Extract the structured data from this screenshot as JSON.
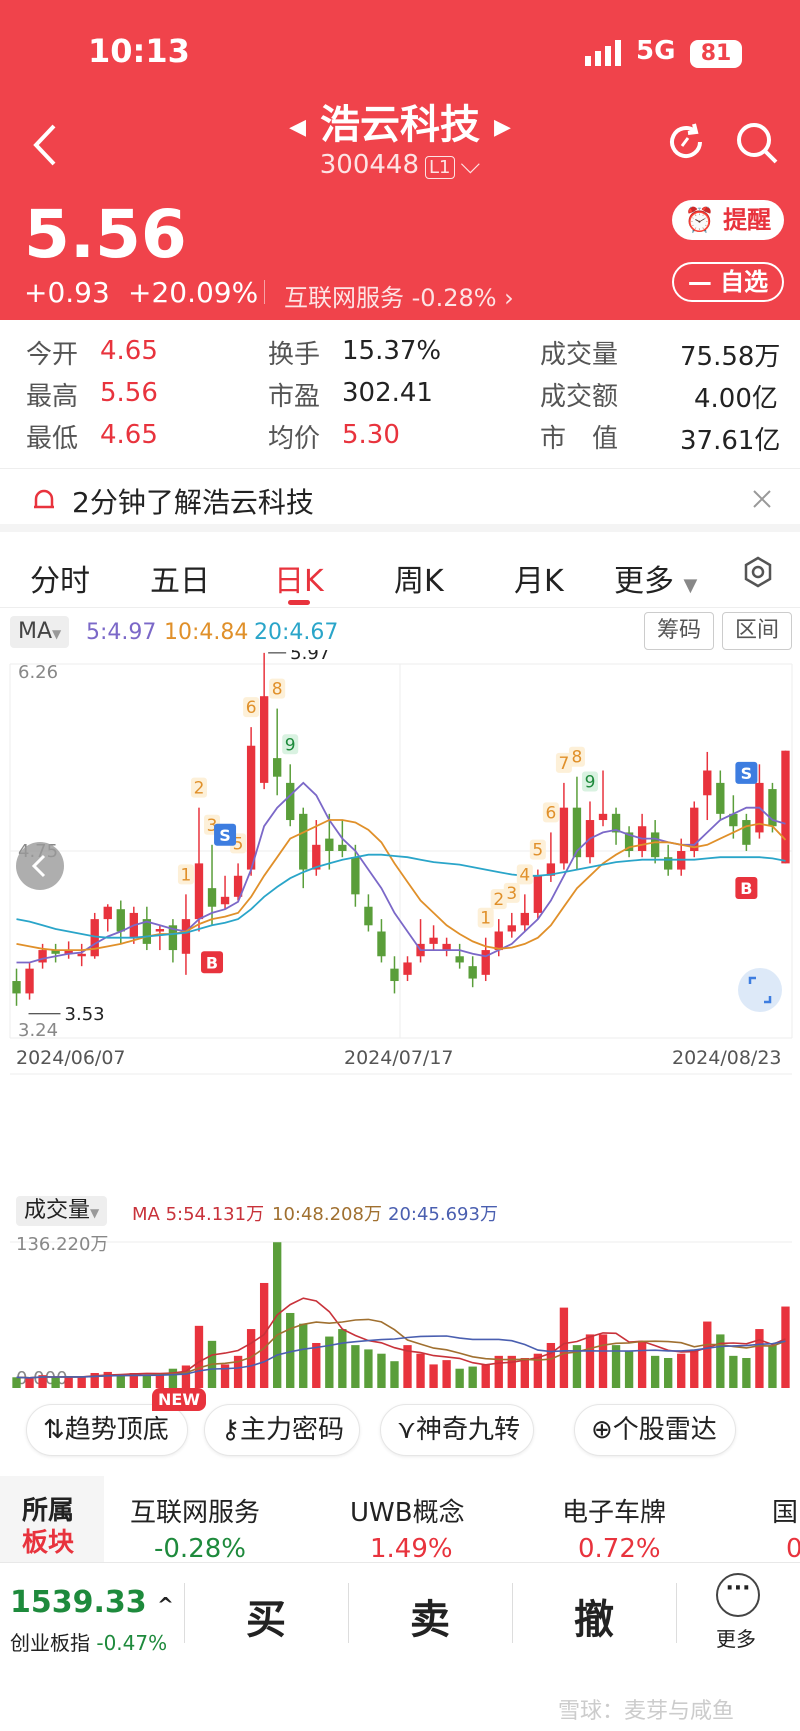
{
  "status": {
    "time": "10:13",
    "network": "5G",
    "battery": "81"
  },
  "header": {
    "name": "浩云科技",
    "code": "300448",
    "level": "L1",
    "remind": "提醒",
    "watch": "自选"
  },
  "quote": {
    "price": "5.56",
    "change": "+0.93",
    "change_pct": "+20.09%",
    "sector": "互联网服务",
    "sector_pct": "-0.28%"
  },
  "stats": [
    {
      "label": "今开",
      "value": "4.65"
    },
    {
      "label": "换手",
      "value": "15.37%"
    },
    {
      "label": "成交量",
      "value": "75.58万"
    },
    {
      "label": "最高",
      "value": "5.56"
    },
    {
      "label": "市盈",
      "value": "302.41"
    },
    {
      "label": "成交额",
      "value": "4.00亿"
    },
    {
      "label": "最低",
      "value": "4.65"
    },
    {
      "label": "均价",
      "value": "5.30"
    },
    {
      "label": "市　值",
      "value": "37.61亿"
    }
  ],
  "learn": "2分钟了解浩云科技",
  "tabs": [
    "分时",
    "五日",
    "日K",
    "周K",
    "月K",
    "更多"
  ],
  "active_tab": "日K",
  "ma": {
    "btn": "MA",
    "ma5": "5:4.97",
    "ma10": "10:4.84",
    "ma20": "20:4.67",
    "chips": "筹码",
    "range": "区间"
  },
  "colors": {
    "up": "#e8333d",
    "down": "#5a9e3a",
    "ma5": "#7b68c8",
    "ma10": "#e0902a",
    "ma20": "#2aa5c9"
  },
  "chart_data": {
    "type": "candlestick",
    "price_range": [
      3.24,
      6.26
    ],
    "y_ticks": [
      "6.26",
      "4.75",
      "3.24"
    ],
    "dates": [
      "2024/06/07",
      "2024/07/17",
      "2024/08/23"
    ],
    "high_label": "5.97",
    "low_label": "3.53",
    "candles": [
      [
        3.7,
        3.6,
        3.8,
        3.5
      ],
      [
        3.6,
        3.8,
        3.85,
        3.55
      ],
      [
        3.85,
        3.95,
        4.0,
        3.8
      ],
      [
        3.95,
        3.92,
        4.0,
        3.85
      ],
      [
        3.92,
        3.95,
        4.02,
        3.88
      ],
      [
        3.9,
        3.92,
        4.0,
        3.82
      ],
      [
        3.9,
        4.2,
        4.25,
        3.88
      ],
      [
        4.2,
        4.3,
        4.32,
        4.1
      ],
      [
        4.28,
        4.1,
        4.35,
        4.0
      ],
      [
        4.05,
        4.25,
        4.3,
        4.0
      ],
      [
        4.2,
        4.0,
        4.3,
        3.95
      ],
      [
        4.1,
        4.12,
        4.15,
        3.95
      ],
      [
        4.15,
        3.95,
        4.2,
        3.85
      ],
      [
        3.92,
        4.2,
        4.4,
        3.75
      ],
      [
        4.2,
        4.65,
        5.1,
        4.1
      ],
      [
        4.45,
        4.3,
        4.8,
        4.15
      ],
      [
        4.32,
        4.38,
        4.55,
        4.28
      ],
      [
        4.38,
        4.55,
        4.65,
        4.35
      ],
      [
        4.6,
        5.6,
        5.75,
        4.55
      ],
      [
        5.3,
        6.0,
        6.35,
        5.25
      ],
      [
        5.5,
        5.35,
        5.9,
        5.2
      ],
      [
        5.3,
        5.0,
        5.45,
        4.95
      ],
      [
        5.05,
        4.6,
        5.1,
        4.45
      ],
      [
        4.6,
        4.8,
        5.0,
        4.55
      ],
      [
        4.85,
        4.75,
        5.05,
        4.6
      ],
      [
        4.8,
        4.75,
        5.0,
        4.7
      ],
      [
        4.7,
        4.4,
        4.8,
        4.3
      ],
      [
        4.3,
        4.15,
        4.4,
        4.1
      ],
      [
        4.1,
        3.9,
        4.2,
        3.85
      ],
      [
        3.8,
        3.7,
        3.9,
        3.6
      ],
      [
        3.75,
        3.85,
        3.9,
        3.7
      ],
      [
        3.9,
        4.0,
        4.2,
        3.85
      ],
      [
        4.0,
        4.05,
        4.15,
        3.95
      ],
      [
        3.95,
        4.0,
        4.05,
        3.9
      ],
      [
        3.9,
        3.85,
        4.0,
        3.8
      ],
      [
        3.82,
        3.72,
        3.9,
        3.65
      ],
      [
        3.75,
        3.95,
        4.05,
        3.7
      ],
      [
        3.95,
        4.1,
        4.2,
        3.9
      ],
      [
        4.1,
        4.15,
        4.25,
        4.05
      ],
      [
        4.15,
        4.25,
        4.4,
        4.1
      ],
      [
        4.25,
        4.55,
        4.6,
        4.2
      ],
      [
        4.55,
        4.65,
        4.9,
        4.5
      ],
      [
        4.65,
        5.1,
        5.3,
        4.6
      ],
      [
        5.1,
        4.7,
        5.35,
        4.6
      ],
      [
        4.7,
        5.0,
        5.15,
        4.65
      ],
      [
        5.0,
        5.05,
        5.4,
        4.95
      ],
      [
        5.05,
        4.9,
        5.1,
        4.8
      ],
      [
        4.9,
        4.75,
        4.95,
        4.7
      ],
      [
        4.75,
        4.95,
        5.05,
        4.7
      ],
      [
        4.9,
        4.7,
        5.0,
        4.65
      ],
      [
        4.7,
        4.6,
        4.8,
        4.55
      ],
      [
        4.6,
        4.75,
        4.85,
        4.55
      ],
      [
        4.75,
        5.1,
        5.15,
        4.7
      ],
      [
        5.2,
        5.4,
        5.55,
        5.0
      ],
      [
        5.3,
        5.05,
        5.4,
        5.0
      ],
      [
        5.05,
        4.95,
        5.2,
        4.85
      ],
      [
        5.0,
        4.8,
        5.05,
        4.75
      ],
      [
        4.9,
        5.3,
        5.45,
        4.85
      ],
      [
        5.25,
        4.95,
        5.3,
        4.9
      ],
      [
        4.65,
        5.56,
        5.56,
        4.65
      ]
    ],
    "ma_lines": {
      "ma5": [
        3.85,
        3.85,
        3.88,
        3.9,
        3.92,
        3.93,
        4.0,
        4.06,
        4.1,
        4.15,
        4.18,
        4.15,
        4.12,
        4.1,
        4.2,
        4.25,
        4.28,
        4.34,
        4.6,
        4.95,
        5.1,
        5.2,
        5.3,
        5.2,
        5.0,
        4.85,
        4.75,
        4.6,
        4.45,
        4.25,
        4.1,
        3.95,
        3.95,
        3.95,
        3.95,
        3.92,
        3.9,
        3.95,
        4.0,
        4.1,
        4.2,
        4.35,
        4.55,
        4.75,
        4.85,
        4.9,
        4.92,
        4.88,
        4.85,
        4.85,
        4.82,
        4.8,
        4.8,
        4.9,
        5.0,
        5.05,
        5.1,
        5.1,
        5.0,
        4.97
      ],
      "ma10": [
        4.0,
        3.98,
        3.96,
        3.95,
        3.95,
        3.95,
        3.96,
        3.98,
        4.0,
        4.03,
        4.06,
        4.08,
        4.08,
        4.1,
        4.16,
        4.2,
        4.22,
        4.25,
        4.38,
        4.55,
        4.7,
        4.85,
        4.9,
        4.95,
        5.0,
        5.0,
        4.98,
        4.92,
        4.82,
        4.65,
        4.5,
        4.35,
        4.25,
        4.15,
        4.08,
        4.02,
        3.98,
        3.96,
        3.97,
        4.0,
        4.05,
        4.15,
        4.3,
        4.45,
        4.55,
        4.65,
        4.72,
        4.78,
        4.8,
        4.82,
        4.82,
        4.8,
        4.78,
        4.8,
        4.85,
        4.9,
        4.95,
        4.97,
        4.95,
        4.84
      ],
      "ma20": [
        4.2,
        4.18,
        4.15,
        4.12,
        4.1,
        4.08,
        4.06,
        4.05,
        4.05,
        4.05,
        4.06,
        4.07,
        4.08,
        4.09,
        4.12,
        4.15,
        4.17,
        4.2,
        4.28,
        4.38,
        4.46,
        4.53,
        4.58,
        4.62,
        4.65,
        4.68,
        4.7,
        4.72,
        4.72,
        4.71,
        4.7,
        4.68,
        4.66,
        4.65,
        4.64,
        4.62,
        4.6,
        4.58,
        4.56,
        4.55,
        4.55,
        4.56,
        4.58,
        4.6,
        4.62,
        4.64,
        4.66,
        4.67,
        4.68,
        4.68,
        4.68,
        4.68,
        4.68,
        4.69,
        4.7,
        4.7,
        4.7,
        4.7,
        4.69,
        4.67
      ]
    },
    "signals": [
      {
        "i": 13,
        "t": "1"
      },
      {
        "i": 14,
        "t": "2"
      },
      {
        "i": 15,
        "t": "3"
      },
      {
        "i": 17,
        "t": "5"
      },
      {
        "i": 18,
        "t": "6"
      },
      {
        "i": 19,
        "t": "7"
      },
      {
        "i": 20,
        "t": "8"
      },
      {
        "i": 21,
        "t": "9"
      },
      {
        "i": 36,
        "t": "1"
      },
      {
        "i": 37,
        "t": "2"
      },
      {
        "i": 38,
        "t": "3"
      },
      {
        "i": 39,
        "t": "4"
      },
      {
        "i": 40,
        "t": "5"
      },
      {
        "i": 41,
        "t": "6"
      },
      {
        "i": 42,
        "t": "7"
      },
      {
        "i": 43,
        "t": "8"
      },
      {
        "i": 44,
        "t": "9"
      }
    ],
    "volume": {
      "label": "成交量",
      "ma5": "MA 5:54.131万",
      "ma10": "10:48.208万",
      "ma20": "20:45.693万",
      "max": "136.220万",
      "min": "0.000",
      "values": [
        10,
        9,
        12,
        10,
        11,
        10,
        14,
        15,
        13,
        14,
        12,
        13,
        18,
        21,
        58,
        44,
        22,
        30,
        55,
        98,
        136,
        70,
        60,
        42,
        48,
        55,
        40,
        36,
        32,
        25,
        40,
        32,
        22,
        26,
        18,
        20,
        22,
        30,
        30,
        28,
        32,
        42,
        75,
        40,
        50,
        50,
        40,
        34,
        44,
        30,
        28,
        32,
        36,
        62,
        50,
        30,
        28,
        55,
        40,
        76
      ]
    }
  },
  "tools": [
    "趋势顶底",
    "主力密码",
    "神奇九转",
    "个股雷达"
  ],
  "new_badge": "NEW",
  "plates": {
    "label1": "所属",
    "label2": "板块",
    "items": [
      {
        "name": "互联网服务",
        "pct": "-0.28%"
      },
      {
        "name": "UWB概念",
        "pct": "1.49%"
      },
      {
        "name": "电子车牌",
        "pct": "0.72%"
      },
      {
        "name": "国",
        "pct": "0"
      }
    ]
  },
  "bottom": {
    "index_value": "1539.33",
    "index_name": "创业板指",
    "index_pct": "-0.47%",
    "buy": "买",
    "sell": "卖",
    "cancel": "撤",
    "more": "更多",
    "watermark": "雪球：麦芽与咸鱼"
  }
}
